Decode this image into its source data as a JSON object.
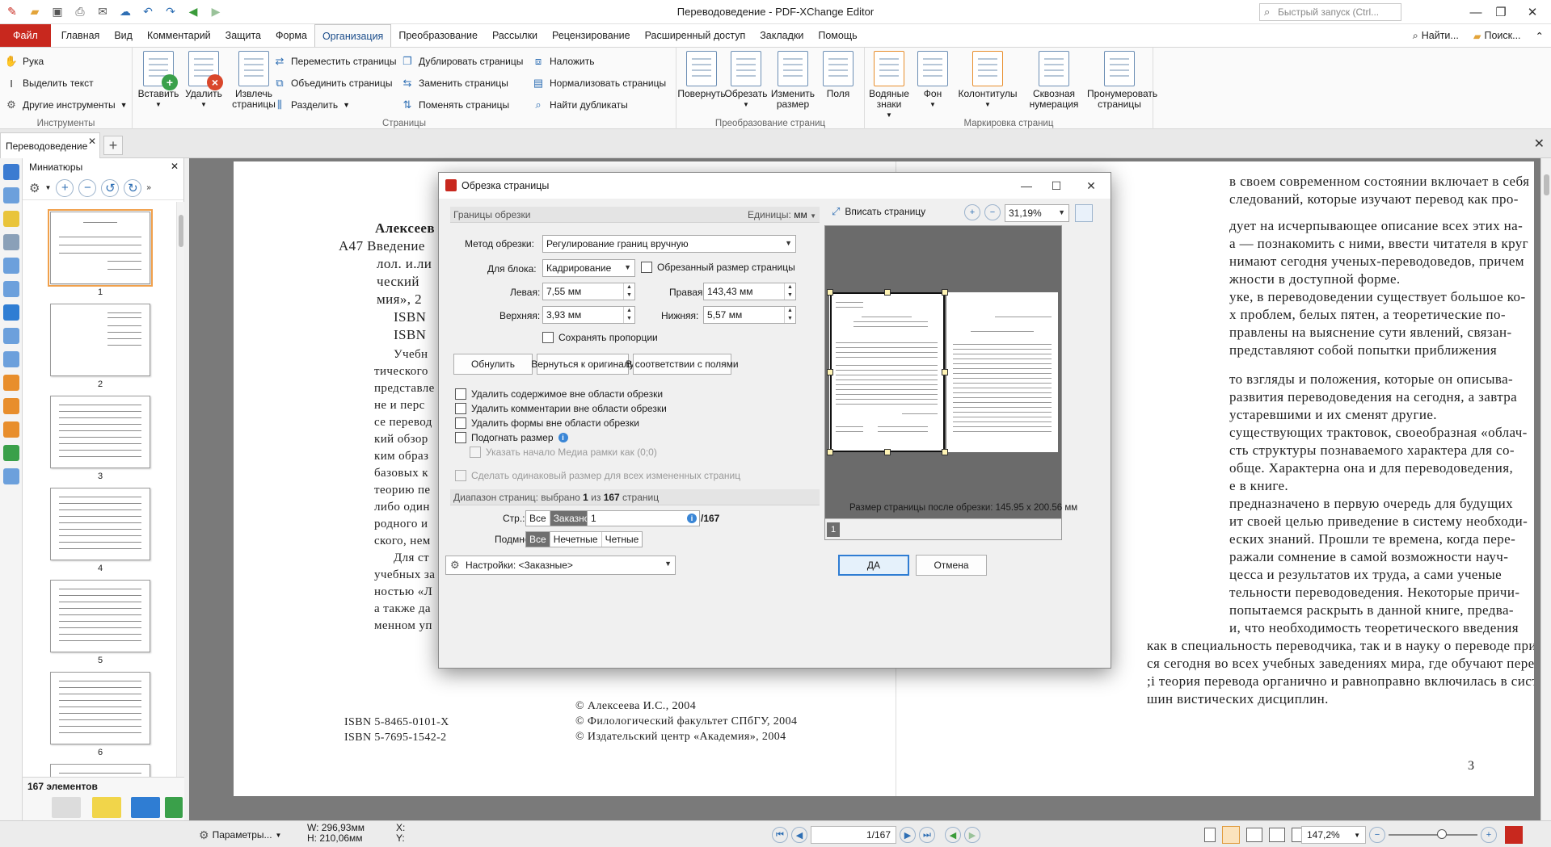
{
  "window": {
    "title": "Переводоведение - PDF-XChange Editor",
    "search_placeholder": "Быстрый запуск (Ctrl..."
  },
  "menu": {
    "file": "Файл",
    "items": [
      "Главная",
      "Вид",
      "Комментарий",
      "Защита",
      "Форма",
      "Организация",
      "Преобразование",
      "Рассылки",
      "Рецензирование",
      "Расширенный доступ",
      "Закладки",
      "Помощь"
    ],
    "find": "Найти...",
    "search": "Поиск..."
  },
  "ribbon": {
    "tools": {
      "hand": "Рука",
      "select_text": "Выделить текст",
      "other_tools": "Другие инструменты",
      "label": "Инструменты"
    },
    "pages": {
      "insert": "Вставить",
      "delete": "Удалить",
      "extract": "Извлечь страницы",
      "move": "Переместить страницы",
      "merge": "Объединить страницы",
      "split": "Разделить",
      "duplicate": "Дублировать страницы",
      "replace": "Заменить страницы",
      "swap": "Поменять страницы",
      "overlay": "Наложить",
      "normalize": "Нормализовать страницы",
      "find_dupes": "Найти дубликаты",
      "label": "Страницы"
    },
    "transform": {
      "rotate": "Повернуть",
      "crop": "Обрезать",
      "resize": "Изменить размер",
      "margins": "Поля",
      "label": "Преобразование страниц"
    },
    "marking": {
      "watermarks": "Водяные знаки",
      "background": "Фон",
      "headers": "Колонтитулы",
      "bates": "Сквозная нумерация",
      "number": "Пронумеровать страницы",
      "label": "Маркировка страниц"
    }
  },
  "doc_tab": "Переводоведение",
  "thumbnails": {
    "title": "Миниатюры",
    "pages": [
      "1",
      "2",
      "3",
      "4",
      "5",
      "6"
    ],
    "count": "167 элементов"
  },
  "page_left": {
    "lines": [
      "Алексеев",
      "А47  Введение",
      "лол. и.ли",
      "ческий",
      "мия», 2",
      "ISBN",
      "ISBN",
      "Учебн",
      "тического",
      "представле",
      "не и перс",
      "се перевод",
      "кий обзор",
      "ким образ",
      "базовых к",
      "теорию пе",
      "либо один",
      "родного и",
      "ского, нем",
      "Для ст",
      "учебных за",
      "ностью «Л",
      "а также да",
      "менном уп"
    ],
    "isbn1": "ISBN  5-8465-0101-X",
    "isbn2": "ISBN  5-7695-1542-2",
    "copy1": "©  Алексеева  И.С.,  2004",
    "copy2": "©  Филологический  факультет  СПбГУ,  2004",
    "copy3": "©  Издательский  центр  «Академия»,  2004"
  },
  "page_right": {
    "lines": [
      "в своем современном состоянии включает в себя",
      "следований, которые изучают перевод как про-",
      "",
      "дует на исчерпывающее описание всех этих на-",
      "а — познакомить с ними, ввести читателя в круг",
      "нимают сегодня ученых-переводоведов, причем",
      "жности в доступной форме.",
      "уке, в переводоведении существует большое ко-",
      "х проблем, белых пятен, а теоретические по-",
      "правлены на выяснение сути явлений, связан-",
      "представляют собой попытки приближения",
      "",
      "то взгляды и положения, которые он описыва-",
      "развития переводоведения на сегодня, а завтра",
      "устаревшими и их сменят другие.",
      "существующих трактовок, своеобразная «облач-",
      "сть структуры познаваемого характера для со-",
      "обще. Характерна она и для переводоведения,",
      "е в книге.",
      "предназначено в первую очередь для будущих",
      "ит своей целью приведение в систему необходи-",
      "еских знаний. Прошли те времена, когда пере-",
      "ражали сомнение в самой возможности науч-",
      "цесса и результатов их труда, а сами ученые",
      "тельности переводоведения. Некоторые причи-",
      "попытаемся раскрыть в данной книге, предва-",
      "и, что необходимость теоретического введения",
      "как в специальность переводчика, так и в науку о переводе признает-",
      "ся сегодня во всех учебных заведениях мира, где обучают переводу,",
      ";і теория перевода органично и равноправно включилась в систему",
      "шин вистических дисциплин."
    ],
    "page_number": "3"
  },
  "dialog": {
    "title": "Обрезка страницы",
    "margins_header": "Границы обрезки",
    "units_label": "Единицы:",
    "units_value": "мм",
    "method_label": "Метод обрезки:",
    "method_value": "Регулирование границ вручную",
    "box_label": "Для блока:",
    "box_value": "Кадрирование",
    "cropped_size": "Обрезанный размер страницы",
    "left_label": "Левая:",
    "left_value": "7,55 мм",
    "right_label": "Правая:",
    "right_value": "143,43 мм",
    "top_label": "Верхняя:",
    "top_value": "3,93 мм",
    "bottom_label": "Нижняя:",
    "bottom_value": "5,57 мм",
    "keep_ratio": "Сохранять пропорции",
    "reset": "Обнулить",
    "revert": "Вернуться к оригиналу",
    "fit_margins": "В соответствии с полями",
    "opt_content": "Удалить содержимое вне области обрезки",
    "opt_comments": "Удалить комментарии вне области обрезки",
    "opt_forms": "Удалить формы вне области обрезки",
    "opt_fit": "Подогнать размер",
    "opt_media": "Указать начало Медиа рамки как (0;0)",
    "opt_same": "Сделать одинаковый размер для всех измененных страниц",
    "range_prefix": "Диапазон страниц: выбрано ",
    "range_selected": "1",
    "range_mid": " из ",
    "range_total": "167",
    "range_suffix": " страниц",
    "pages_label": "Стр.:",
    "pages_all": "Все",
    "pages_custom": "Заказной:",
    "pages_value": "1",
    "pages_of": "/167",
    "subset_label": "Подмнож:",
    "subset_all": "Все",
    "subset_odd": "Нечетные",
    "subset_even": "Четные",
    "fit_page": "Вписать страницу",
    "zoom": "31,19%",
    "preview_page": "1",
    "size_after": "Размер страницы после обрезки: 145.95 x 200.56 мм",
    "settings": "Настройки: <Заказные>",
    "ok": "ДА",
    "cancel": "Отмена"
  },
  "status": {
    "options": "Параметры...",
    "width": "W: 296,93мм",
    "height": "H: 210,06мм",
    "x": "X:",
    "y": "Y:",
    "page": "1/167",
    "zoom": "147,2%"
  }
}
